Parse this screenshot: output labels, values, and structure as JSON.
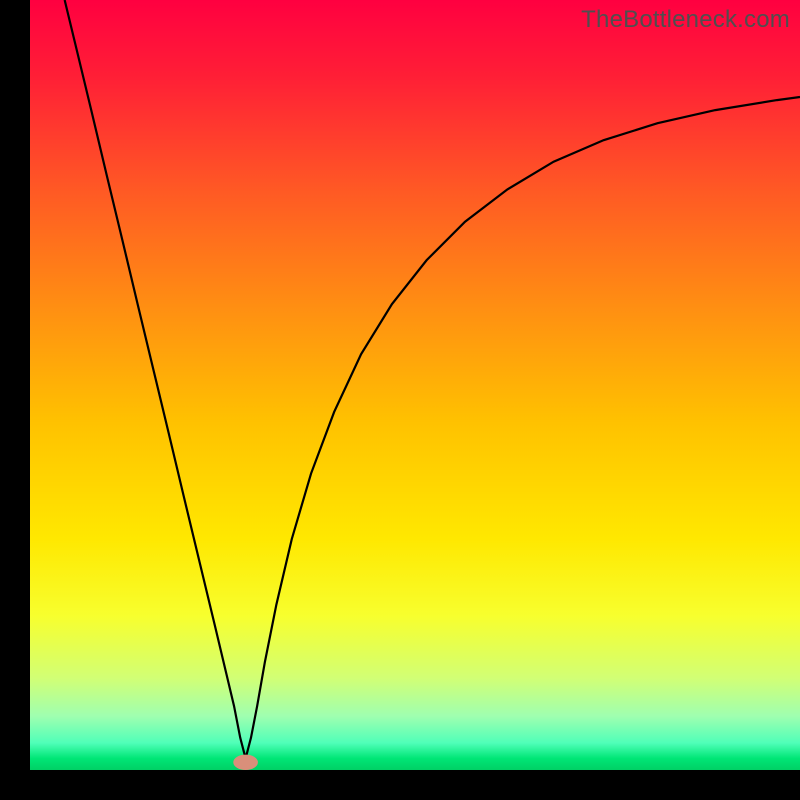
{
  "watermark": "TheBottleneck.com",
  "chart_data": {
    "type": "line",
    "title": "",
    "xlabel": "",
    "ylabel": "",
    "xlim": [
      0,
      1
    ],
    "ylim": [
      0,
      1
    ],
    "background_gradient": {
      "stops": [
        {
          "offset": 0.0,
          "color": "#ff0040"
        },
        {
          "offset": 0.1,
          "color": "#ff1f36"
        },
        {
          "offset": 0.25,
          "color": "#ff5a24"
        },
        {
          "offset": 0.4,
          "color": "#ff8f12"
        },
        {
          "offset": 0.55,
          "color": "#ffc200"
        },
        {
          "offset": 0.7,
          "color": "#ffe800"
        },
        {
          "offset": 0.8,
          "color": "#f7ff2e"
        },
        {
          "offset": 0.88,
          "color": "#d2ff74"
        },
        {
          "offset": 0.93,
          "color": "#9fffb0"
        },
        {
          "offset": 0.965,
          "color": "#4fffb8"
        },
        {
          "offset": 0.985,
          "color": "#00e676"
        },
        {
          "offset": 1.0,
          "color": "#00d065"
        }
      ]
    },
    "series": [
      {
        "name": "curve",
        "color": "#000000",
        "width": 2.2,
        "x": [
          0.045,
          0.06,
          0.08,
          0.1,
          0.12,
          0.14,
          0.16,
          0.18,
          0.2,
          0.22,
          0.24,
          0.255,
          0.265,
          0.273,
          0.28,
          0.287,
          0.295,
          0.305,
          0.32,
          0.34,
          0.365,
          0.395,
          0.43,
          0.47,
          0.515,
          0.565,
          0.62,
          0.68,
          0.745,
          0.815,
          0.89,
          0.97,
          1.0
        ],
        "y": [
          1.0,
          0.938,
          0.855,
          0.771,
          0.688,
          0.604,
          0.521,
          0.438,
          0.354,
          0.271,
          0.188,
          0.125,
          0.083,
          0.042,
          0.015,
          0.042,
          0.083,
          0.14,
          0.215,
          0.3,
          0.385,
          0.465,
          0.54,
          0.605,
          0.662,
          0.712,
          0.754,
          0.79,
          0.818,
          0.84,
          0.857,
          0.87,
          0.874
        ]
      }
    ],
    "marker": {
      "name": "min-marker",
      "cx": 0.28,
      "cy": 0.01,
      "rx": 0.016,
      "ry": 0.01,
      "color": "#d98f7a"
    }
  }
}
